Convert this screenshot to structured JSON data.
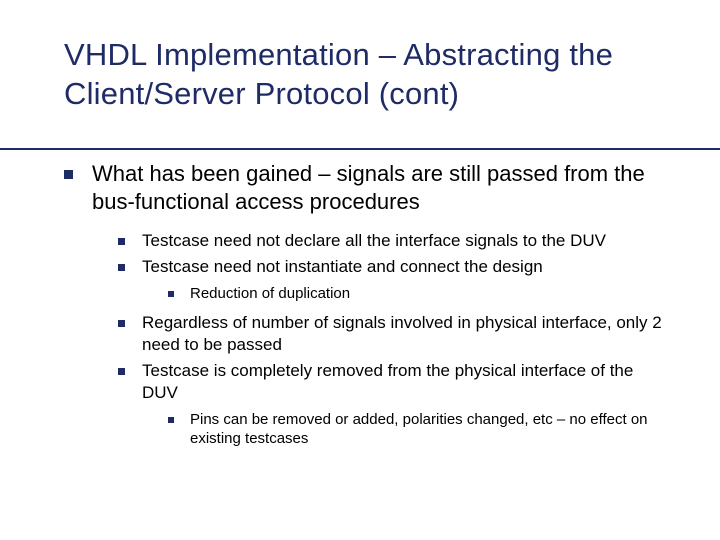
{
  "title": "VHDL Implementation – Abstracting the Client/Server Protocol (cont)",
  "b1": "What has been gained – signals are still passed from the bus-functional access procedures",
  "b1_1": "Testcase need not declare all the interface signals to the DUV",
  "b1_2": "Testcase need not instantiate and connect the design",
  "b1_2_1": "Reduction of duplication",
  "b1_3": "Regardless of number of signals involved in physical interface, only 2 need to be passed",
  "b1_4": "Testcase is completely removed from the physical interface of the DUV",
  "b1_4_1": "Pins can be removed or added, polarities changed, etc – no effect on existing testcases"
}
